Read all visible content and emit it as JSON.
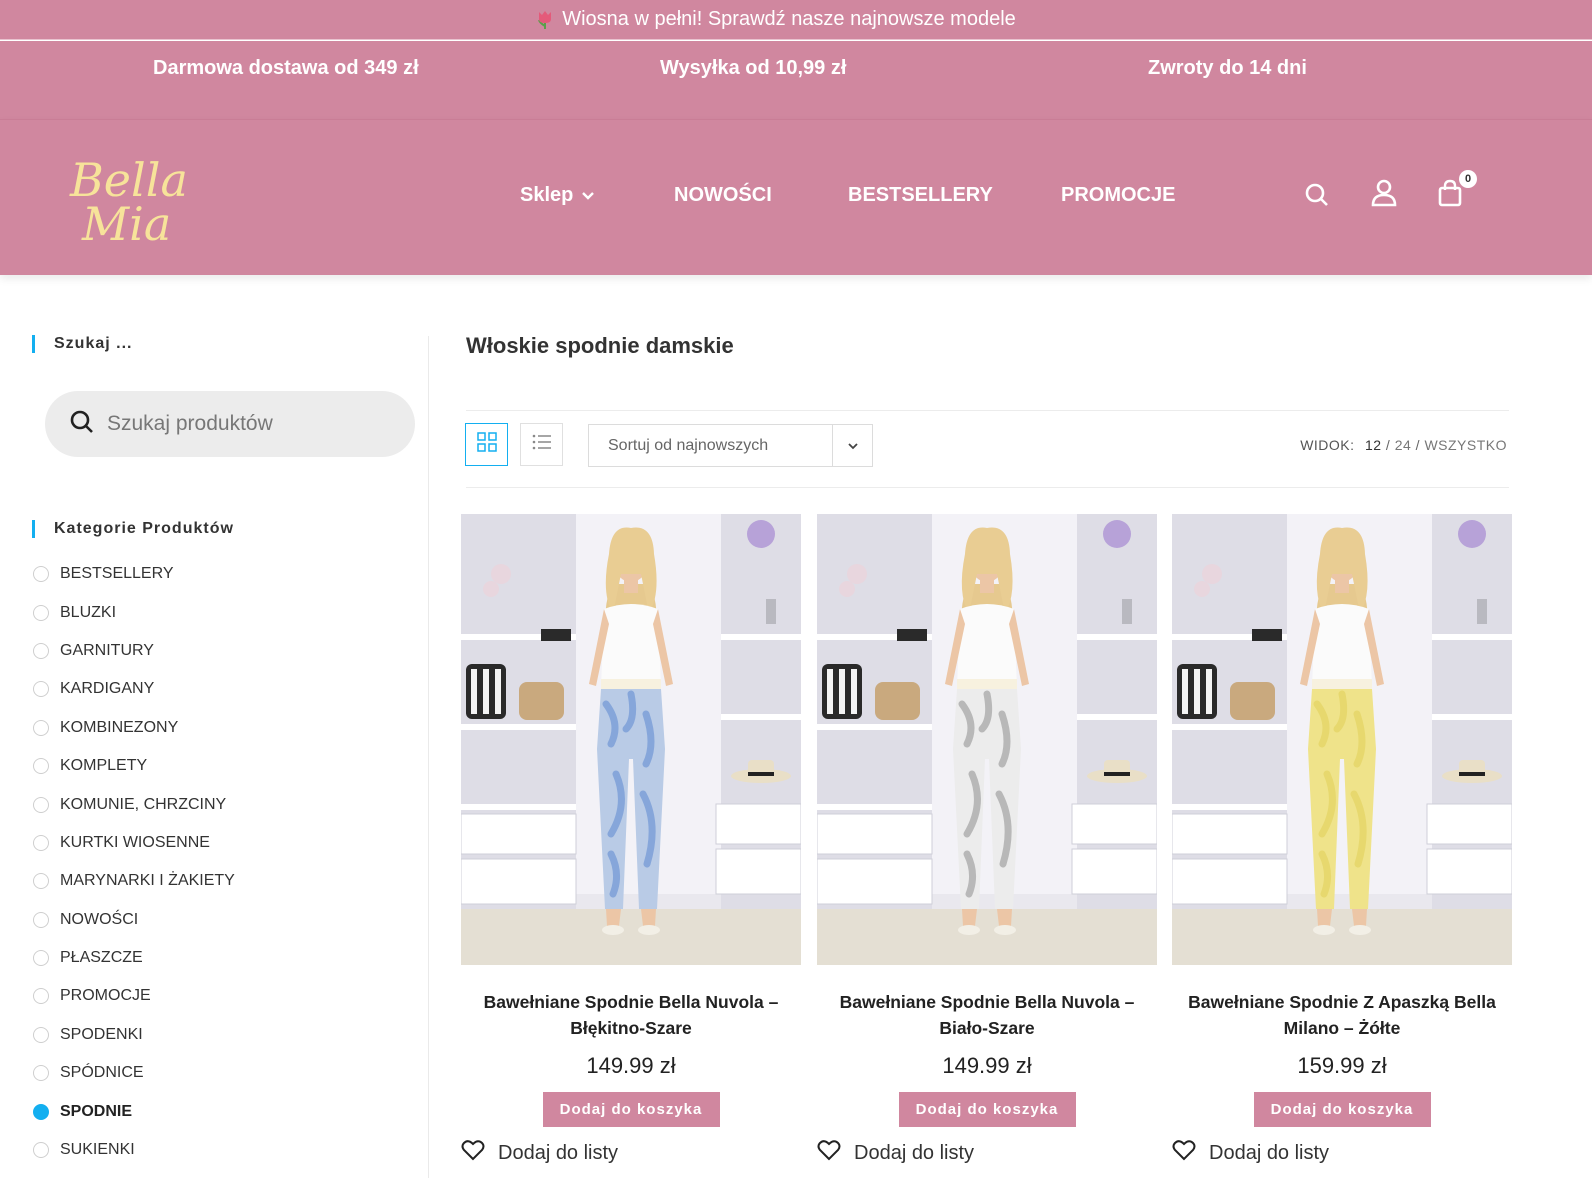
{
  "announcement": {
    "text": "Wiosna w pełni! Sprawdź nasze najnowsze modele",
    "icon": "tulip-icon"
  },
  "benefits": [
    "Darmowa dostawa od 349 zł",
    "Wysyłka od 10,99 zł",
    "Zwroty do 14 dni"
  ],
  "brand": {
    "name": "Bella Mia",
    "line1": "Bella",
    "line2": "Mia",
    "color": "#f7e39a"
  },
  "nav": {
    "shop": "Sklep",
    "new": "NOWOŚCI",
    "best": "BESTSELLERY",
    "promo": "PROMOCJE"
  },
  "header_icons": {
    "search": "search-icon",
    "account": "user-icon",
    "cart": "cart-icon",
    "cart_count": "0"
  },
  "sidebar": {
    "search_title": "Szukaj ...",
    "search_placeholder": "Szukaj produktów",
    "categories_title": "Kategorie Produktów",
    "categories": [
      "BESTSELLERY",
      "BLUZKI",
      "GARNITURY",
      "KARDIGANY",
      "KOMBINEZONY",
      "KOMPLETY",
      "KOMUNIE, CHRZCINY",
      "KURTKI WIOSENNE",
      "MARYNARKI I ŻAKIETY",
      "NOWOŚCI",
      "PŁASZCZE",
      "PROMOCJE",
      "SPODENKI",
      "SPÓDNICE",
      "SPODNIE",
      "SUKIENKI"
    ],
    "active_category": "SPODNIE"
  },
  "main": {
    "title": "Włoskie spodnie damskie",
    "sort_label": "Sortuj od najnowszych",
    "view_label": "WIDOK:",
    "view_current": "12",
    "view_24": "24",
    "view_all": "WSZYSTKO",
    "sep": "/"
  },
  "products": [
    {
      "name": "Bawełniane Spodnie Bella Nuvola – Błękitno-Szare",
      "price": "149.99 zł",
      "button": "Dodaj do koszyka",
      "wishlist": "Dodaj do listy",
      "pants_color": "#b9cbe6",
      "pattern_color": "#86a6da"
    },
    {
      "name": "Bawełniane Spodnie Bella Nuvola – Biało-Szare",
      "price": "149.99 zł",
      "button": "Dodaj do koszyka",
      "wishlist": "Dodaj do listy",
      "pants_color": "#ececec",
      "pattern_color": "#b8b8b8"
    },
    {
      "name": "Bawełniane Spodnie Z Apaszką Bella Milano – Żółte",
      "price": "159.99 zł",
      "button": "Dodaj do koszyka",
      "wishlist": "Dodaj do listy",
      "pants_color": "#efe38a",
      "pattern_color": "#e7d86e"
    }
  ],
  "colors": {
    "brand_pink": "#d0879f",
    "accent_blue": "#13aff0"
  }
}
